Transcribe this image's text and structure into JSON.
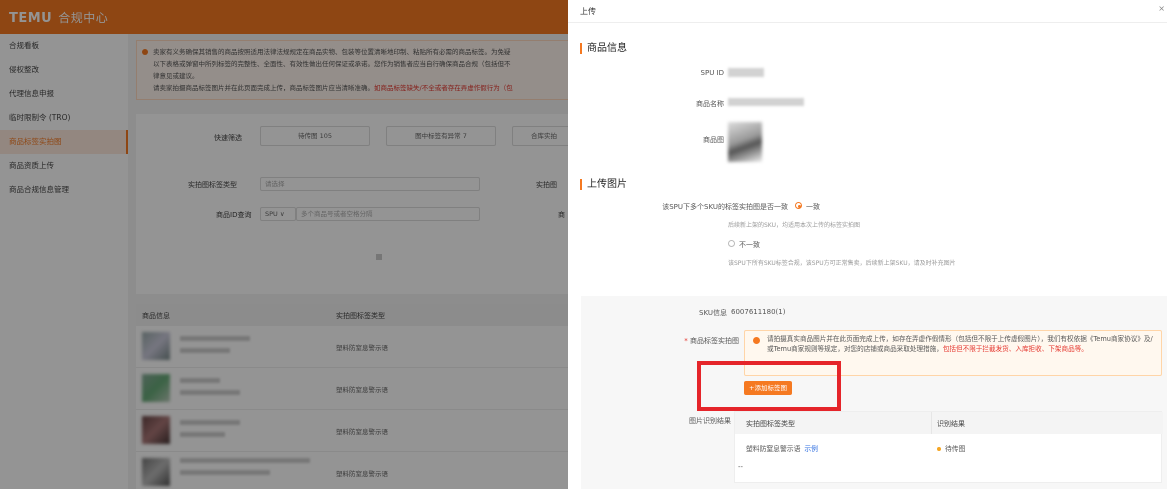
{
  "app": {
    "brand": "TEMU",
    "title": "合规中心"
  },
  "sidebar": {
    "items": [
      {
        "label": "合规看板"
      },
      {
        "label": "侵权整改"
      },
      {
        "label": "代理信息申报"
      },
      {
        "label": "临时限制令 (TRO)"
      },
      {
        "label": "商品标签实拍图"
      },
      {
        "label": "商品资质上传"
      },
      {
        "label": "商品合规信息管理"
      }
    ],
    "active_index": 4
  },
  "notice": {
    "line1": "卖家有义务确保其销售的商品按照适用法律法规规定在商品实物、包装等位置清晰地印制、粘贴所有必需的商品标签。为免疑",
    "line2": "以下表格或弹窗中所列标签的完整性、全面性、有效性做出任何保证或承诺。您作为销售者应当自行确保商品合规（包括但不",
    "line3": "律意见或建议。",
    "line4": "请卖家拍摄商品标签图片并在此页面完成上传，商品标签图片应当清晰准确。",
    "line4_red": "如商品标签缺失/不全或者存在弄虚作假行为（包"
  },
  "filters": {
    "quick_label": "快速筛选",
    "chips": [
      "待传图 105",
      "图中标签有异常 7",
      "合库实拍"
    ],
    "type_label": "实拍图标签类型",
    "type_placeholder": "请选择",
    "type_label2": "实拍图",
    "id_label": "商品ID查询",
    "id_select": "SPU",
    "id_placeholder": "多个商品号或者空格分隔",
    "id_label2": "商"
  },
  "bg_table": {
    "headers": [
      "商品信息",
      "实拍图标签类型"
    ],
    "rows": [
      {
        "type": "塑料防窒息警示语"
      },
      {
        "type": "塑料防窒息警示语"
      },
      {
        "type": "塑料防窒息警示语"
      },
      {
        "type": "塑料防窒息警示语"
      }
    ]
  },
  "drawer": {
    "title": "上传",
    "close": "×",
    "section1": "商品信息",
    "spu_label": "SPU ID",
    "name_label": "商品名称",
    "image_label": "商品图",
    "section2": "上传图片",
    "question": "该SPU下多个SKU的标签实拍图是否一致",
    "opt1": "一致",
    "opt1_hint": "后续新上架的SKU，均适用本次上传的标签实拍图",
    "opt2": "不一致",
    "opt2_hint": "该SPU下所有SKU标签合规，该SPU方可正常售卖，后续新上架SKU，请及时补充图片",
    "sku_label": "SKU信息",
    "sku_value": "6007611180(1)",
    "upload_label": "商品标签实拍图",
    "warning_text": "请拍摄真实商品图片并在此页面完成上传，如存在弄虚作假情形（包括但不限于上传虚假图片），我们有权依据《Temu商家协议》及/或Temu商家规则等规定，对您的店铺或商品采取处理措施，",
    "warning_red": "包括但不限于拦截发货、入库拒收、下架商品等。",
    "add_button": "+添加标签图",
    "result_label": "图片识别结果",
    "result_headers": [
      "实拍图标签类型",
      "识别结果"
    ],
    "result_type": "塑料防窒息警示语",
    "result_link": "示例",
    "result_status": "待传图",
    "result_extra": "--"
  },
  "colors": {
    "brand": "#f57921",
    "highlight": "#e5252a",
    "link": "#2f6fe0"
  }
}
